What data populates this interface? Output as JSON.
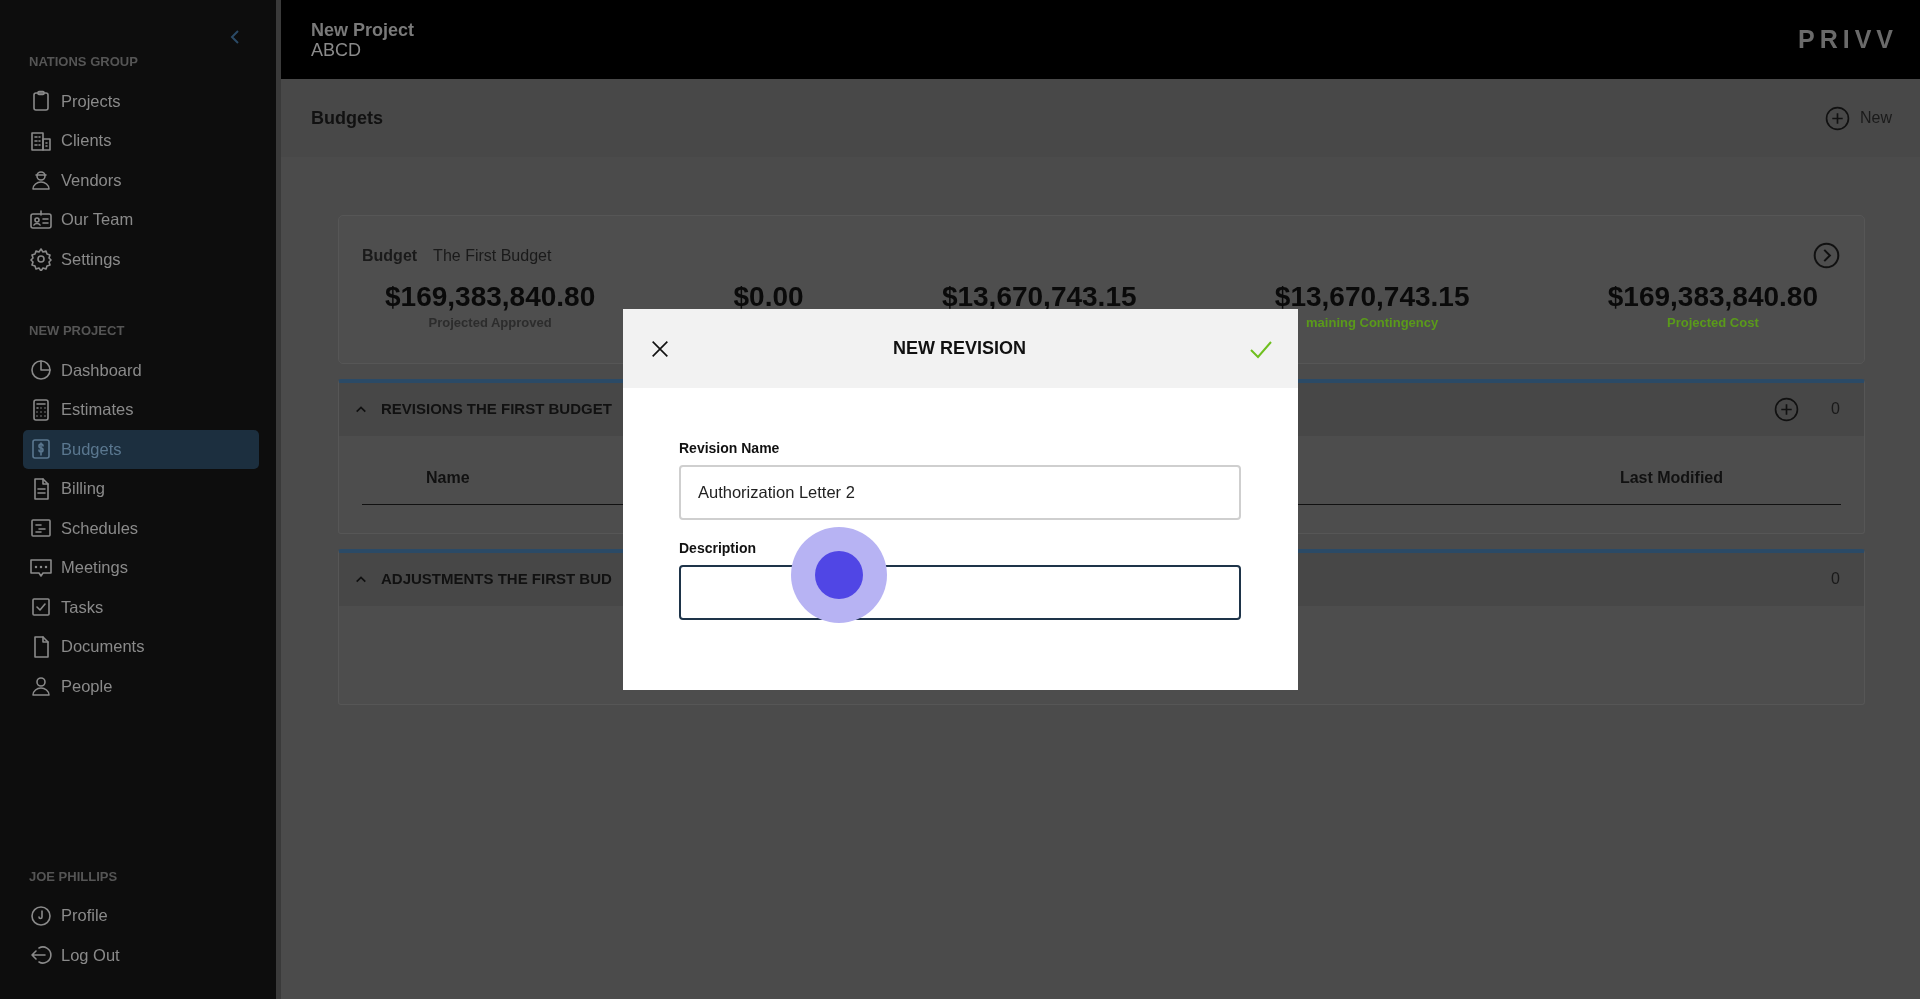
{
  "sidebar": {
    "sections": [
      {
        "title": "NATIONS GROUP",
        "items": [
          {
            "label": "Projects",
            "selected": false
          },
          {
            "label": "Clients",
            "selected": false
          },
          {
            "label": "Vendors",
            "selected": false
          },
          {
            "label": "Our Team",
            "selected": false
          },
          {
            "label": "Settings",
            "selected": false
          }
        ]
      },
      {
        "title": "NEW PROJECT",
        "items": [
          {
            "label": "Dashboard",
            "selected": false
          },
          {
            "label": "Estimates",
            "selected": false
          },
          {
            "label": "Budgets",
            "selected": true
          },
          {
            "label": "Billing",
            "selected": false
          },
          {
            "label": "Schedules",
            "selected": false
          },
          {
            "label": "Meetings",
            "selected": false
          },
          {
            "label": "Tasks",
            "selected": false
          },
          {
            "label": "Documents",
            "selected": false
          },
          {
            "label": "People",
            "selected": false
          }
        ]
      },
      {
        "title": "JOE PHILLIPS",
        "items": [
          {
            "label": "Profile",
            "selected": false
          },
          {
            "label": "Log Out",
            "selected": false
          }
        ]
      }
    ]
  },
  "header": {
    "title": "New Project",
    "subtitle": "ABCD",
    "logo": "PRIVV"
  },
  "page": {
    "title": "Budgets",
    "new_button": "New"
  },
  "budget": {
    "label": "Budget",
    "name": "The First Budget",
    "stats": [
      {
        "value": "$169,383,840.80",
        "label": "Projected Approved",
        "color": "#2c2c2c"
      },
      {
        "value": "$0.00"
      },
      {
        "value": "$13,670,743.15"
      },
      {
        "value": "$13,670,743.15",
        "label": "maining Contingency",
        "color": "#5a9a1a"
      },
      {
        "value": "$169,383,840.80",
        "label": "Projected Cost",
        "color": "#5a9a1a"
      }
    ]
  },
  "revisions": {
    "title": "REVISIONS THE FIRST BUDGET",
    "count": "0",
    "expanded": true,
    "columns": [
      "Name",
      "Last Modified"
    ]
  },
  "adjustments": {
    "title": "ADJUSTMENTS THE FIRST BUD",
    "count": "0",
    "expanded": true
  },
  "modal": {
    "title": "NEW REVISION",
    "fields": [
      {
        "label": "Revision Name",
        "value": "Authorization Letter 2",
        "focused": false
      },
      {
        "label": "Description",
        "focused": true
      }
    ]
  }
}
